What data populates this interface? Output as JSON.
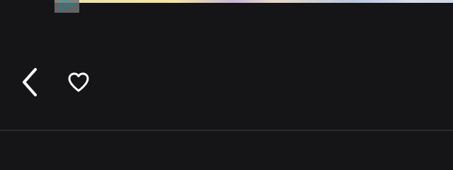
{
  "media": {
    "strip_colors": [
      "#e9e2b0",
      "#c7b7d8",
      "#b9c6de",
      "#cfd6e4"
    ],
    "thumbnail_icon": "play-triangle-icon",
    "accent": "#2f8c9a"
  },
  "toolbar": {
    "back_icon": "chevron-left-icon",
    "favorite_icon": "heart-outline-icon",
    "icon_color": "#ffffff"
  },
  "theme": {
    "background": "#151517",
    "divider": "#2a2a2d"
  }
}
